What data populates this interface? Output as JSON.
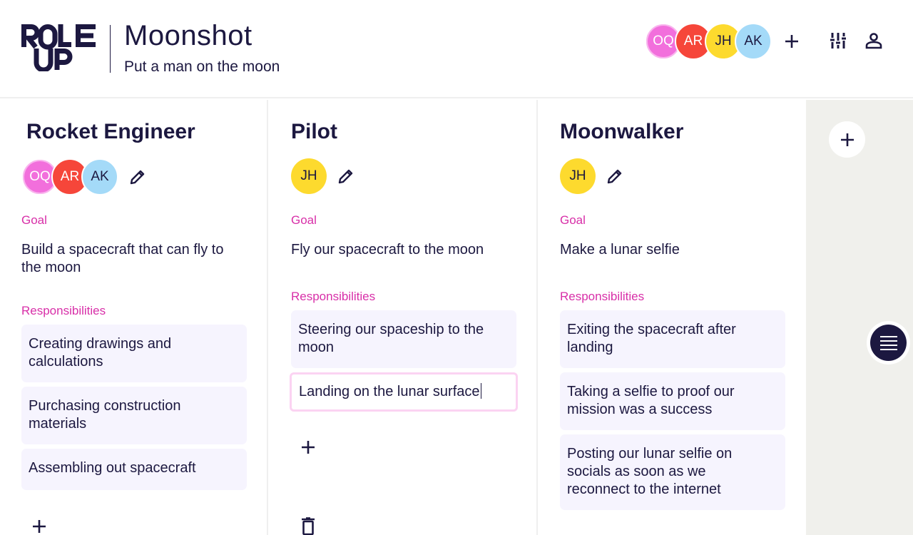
{
  "header": {
    "logo_text": "ROLE UP",
    "project_title": "Moonshot",
    "project_subtitle": "Put a man on the moon",
    "members": [
      {
        "initials": "OQ",
        "color": "#f26fdc"
      },
      {
        "initials": "AR",
        "color": "#f6463a"
      },
      {
        "initials": "JH",
        "color": "#fdda2e"
      },
      {
        "initials": "AK",
        "color": "#a4daf8"
      }
    ],
    "icons": {
      "add_member": "plus-icon",
      "filter": "sliders-icon",
      "account": "user-icon"
    }
  },
  "labels": {
    "goal": "Goal",
    "responsibilities": "Responsibilities"
  },
  "roles": [
    {
      "title": "Rocket Engineer",
      "members": [
        "OQ",
        "AR",
        "AK"
      ],
      "goal": "Build a spacecraft that can fly to the moon",
      "responsibilities": [
        "Creating drawings and calculations",
        "Purchasing construction materials",
        "Assembling out spacecraft"
      ]
    },
    {
      "title": "Pilot",
      "members": [
        "JH"
      ],
      "goal": "Fly our spacecraft to the moon",
      "responsibilities": [
        "Steering our spaceship to the moon"
      ],
      "editing_responsibility": "Landing on the lunar surface"
    },
    {
      "title": "Moonwalker",
      "members": [
        "JH"
      ],
      "goal": "Make a lunar selfie",
      "responsibilities": [
        "Exiting the spacecraft after landing",
        "Taking a selfie to proof our mission was a success",
        "Posting our lunar selfie on socials as soon as we reconnect to the internet"
      ]
    }
  ],
  "colors": {
    "primary": "#1c1840",
    "accent": "#d82fa8",
    "card_bg": "#f6f4fe",
    "edit_border": "#fbd3f2",
    "sidebar_bg": "#f0f0ec"
  }
}
